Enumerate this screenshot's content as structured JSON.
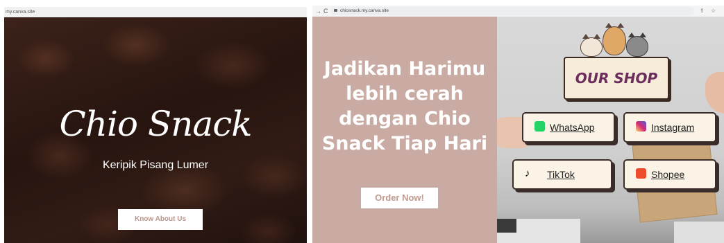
{
  "left": {
    "url": "my.canva.site",
    "title": "Chio Snack",
    "subtitle": "Keripik Pisang Lumer",
    "button_label": "Know About Us"
  },
  "right": {
    "browser": {
      "back_icon": "arrow-right-icon",
      "reload_icon": "reload-icon",
      "url": "chiosnack.my.canva.site"
    },
    "headline": "Jadikan Harimu lebih cerah dengan Chio Snack Tiap Hari",
    "order_button": "Order Now!",
    "shop": {
      "sign_label": "OUR SHOP",
      "buttons": [
        {
          "label": "WhatsApp",
          "icon": "whatsapp-icon",
          "color": "#25d366"
        },
        {
          "label": "Instagram",
          "icon": "instagram-icon",
          "color": "#d62976"
        },
        {
          "label": "TikTok",
          "icon": "tiktok-icon",
          "color": "#111111"
        },
        {
          "label": "Shopee",
          "icon": "shopee-icon",
          "color": "#ee4d2d"
        }
      ]
    }
  },
  "colors": {
    "pink_panel": "#c9aba3",
    "sign_text": "#6b2d5c"
  }
}
